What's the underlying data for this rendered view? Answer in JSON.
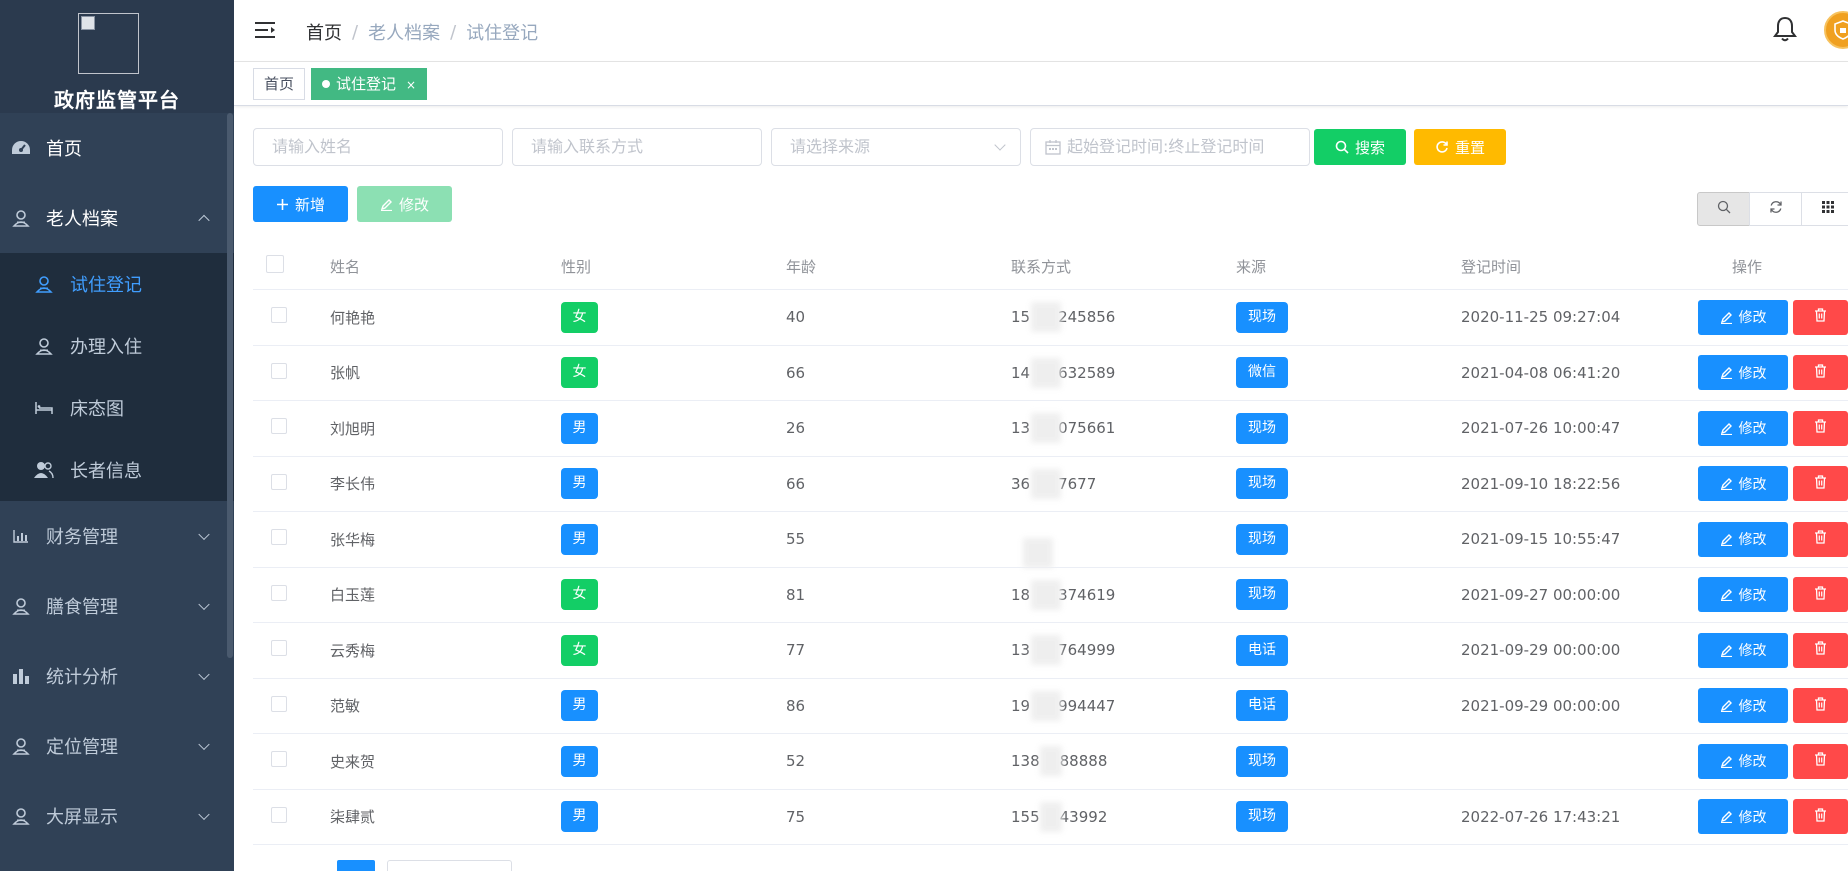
{
  "sidebar": {
    "title": "政府监管平台",
    "menu": [
      {
        "label": "首页",
        "icon": "dashboard-icon"
      },
      {
        "label": "老人档案",
        "icon": "elder-icon",
        "open": true,
        "children": [
          {
            "label": "试住登记",
            "icon": "elder-icon",
            "active": true
          },
          {
            "label": "办理入住",
            "icon": "elder-icon"
          },
          {
            "label": "床态图",
            "icon": "bed-icon"
          },
          {
            "label": "长者信息",
            "icon": "people-icon"
          }
        ]
      },
      {
        "label": "财务管理",
        "icon": "finance-chart-icon"
      },
      {
        "label": "膳食管理",
        "icon": "elder-icon"
      },
      {
        "label": "统计分析",
        "icon": "bar-chart-icon"
      },
      {
        "label": "定位管理",
        "icon": "elder-icon"
      },
      {
        "label": "大屏显示",
        "icon": "elder-icon"
      }
    ]
  },
  "header": {
    "breadcrumb": [
      "首页",
      "老人档案",
      "试住登记"
    ],
    "separator": "/"
  },
  "tags": {
    "home": "首页",
    "current": "试住登记",
    "close": "×"
  },
  "search": {
    "name_placeholder": "请输入姓名",
    "contact_placeholder": "请输入联系方式",
    "source_placeholder": "请选择来源",
    "start_placeholder": "起始登记时间",
    "date_separator": ":",
    "end_placeholder": "终止登记时间",
    "search_label": "搜索",
    "reset_label": "重置"
  },
  "toolbar": {
    "add_label": "新增",
    "edit_label": "修改"
  },
  "table": {
    "columns": [
      "姓名",
      "性别",
      "年龄",
      "联系方式",
      "来源",
      "登记时间",
      "操作"
    ],
    "edit_label": "修改",
    "rows": [
      {
        "name": "何艳艳",
        "gender": "女",
        "age": "40",
        "contact_visible": "15__245856",
        "contact_pre": "15",
        "contact_post": "245856",
        "source": "现场",
        "time": "2020-11-25 09:27:04"
      },
      {
        "name": "张帆",
        "gender": "女",
        "age": "66",
        "contact_pre": "14",
        "contact_post": "632589",
        "source": "微信",
        "time": "2021-04-08 06:41:20"
      },
      {
        "name": "刘旭明",
        "gender": "男",
        "age": "26",
        "contact_pre": "13",
        "contact_post": "075661",
        "source": "现场",
        "time": "2021-07-26 10:00:47"
      },
      {
        "name": "李长伟",
        "gender": "男",
        "age": "66",
        "contact_pre": "36",
        "contact_post": "7677",
        "source": "现场",
        "time": "2021-09-10 18:22:56"
      },
      {
        "name": "张华梅",
        "gender": "男",
        "age": "55",
        "contact_pre": "",
        "contact_post": "",
        "source": "现场",
        "time": "2021-09-15 10:55:47"
      },
      {
        "name": "白玉莲",
        "gender": "女",
        "age": "81",
        "contact_pre": "18",
        "contact_post": "374619",
        "source": "现场",
        "time": "2021-09-27 00:00:00"
      },
      {
        "name": "云秀梅",
        "gender": "女",
        "age": "77",
        "contact_pre": "13",
        "contact_post": "764999",
        "source": "电话",
        "time": "2021-09-29 00:00:00"
      },
      {
        "name": "范敏",
        "gender": "男",
        "age": "86",
        "contact_pre": "19",
        "contact_post": "994447",
        "source": "电话",
        "time": "2021-09-29 00:00:00"
      },
      {
        "name": "史来贺",
        "gender": "男",
        "age": "52",
        "contact_pre": "138",
        "contact_post": "88888",
        "source": "现场",
        "time": ""
      },
      {
        "name": "柒肆贰",
        "gender": "男",
        "age": "75",
        "contact_pre": "155",
        "contact_post": "43992",
        "source": "现场",
        "time": "2022-07-26 17:43:21"
      }
    ]
  },
  "colors": {
    "sidebar_bg": "#304156",
    "submenu_bg": "#1f2d3d",
    "active_menu": "#409eff",
    "primary": "#1890ff",
    "success": "#13ce66",
    "warning": "#ffba00",
    "danger": "#ff4949",
    "tag_active": "#42b983"
  }
}
